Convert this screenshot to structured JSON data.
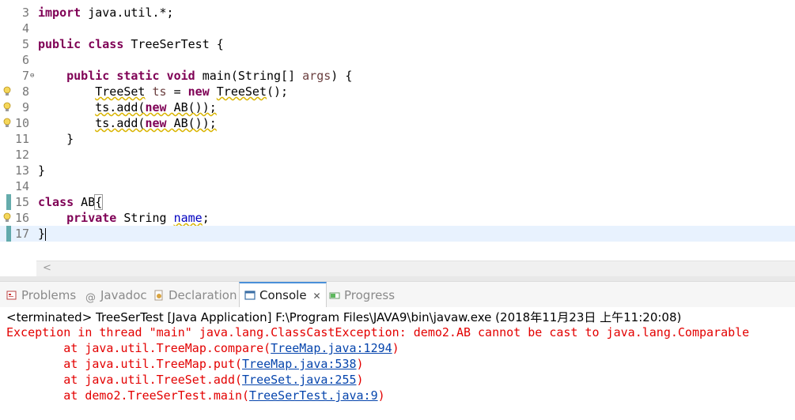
{
  "editor": {
    "lines": [
      {
        "n": "3",
        "tokens": [
          {
            "t": "import",
            "c": "kw"
          },
          {
            "t": " java.util.*;"
          }
        ]
      },
      {
        "n": "4",
        "tokens": []
      },
      {
        "n": "5",
        "tokens": [
          {
            "t": "public",
            "c": "kw"
          },
          {
            "t": " "
          },
          {
            "t": "class",
            "c": "kw"
          },
          {
            "t": " TreeSerTest {"
          }
        ]
      },
      {
        "n": "6",
        "tokens": []
      },
      {
        "n": "7",
        "fold": "⊖",
        "tokens": [
          {
            "t": "    "
          },
          {
            "t": "public",
            "c": "kw"
          },
          {
            "t": " "
          },
          {
            "t": "static",
            "c": "kw"
          },
          {
            "t": " "
          },
          {
            "t": "void",
            "c": "kw"
          },
          {
            "t": " main(String[] "
          },
          {
            "t": "args",
            "c": "param"
          },
          {
            "t": ") {"
          }
        ]
      },
      {
        "n": "8",
        "marker": "warning-lightbulb",
        "tokens": [
          {
            "t": "        "
          },
          {
            "t": "TreeSet",
            "c": "warn"
          },
          {
            "t": " "
          },
          {
            "t": "ts",
            "c": "param"
          },
          {
            "t": " = "
          },
          {
            "t": "new",
            "c": "kw"
          },
          {
            "t": " "
          },
          {
            "t": "TreeSet",
            "c": "warn"
          },
          {
            "t": "();"
          }
        ]
      },
      {
        "n": "9",
        "marker": "warning-lightbulb",
        "tokens": [
          {
            "t": "        "
          },
          {
            "t": "ts.add(",
            "c": "warn"
          },
          {
            "t": "new",
            "c": "kw warn"
          },
          {
            "t": " AB());",
            "c": "warn"
          }
        ]
      },
      {
        "n": "10",
        "marker": "warning-lightbulb",
        "tokens": [
          {
            "t": "        "
          },
          {
            "t": "ts.add(",
            "c": "warn"
          },
          {
            "t": "new",
            "c": "kw warn"
          },
          {
            "t": " AB());",
            "c": "warn"
          }
        ]
      },
      {
        "n": "11",
        "tokens": [
          {
            "t": "    }"
          }
        ]
      },
      {
        "n": "12",
        "tokens": []
      },
      {
        "n": "13",
        "tokens": [
          {
            "t": "}"
          }
        ]
      },
      {
        "n": "14",
        "tokens": []
      },
      {
        "n": "15",
        "ov": true,
        "tokens": [
          {
            "t": "class",
            "c": "kw"
          },
          {
            "t": " AB"
          },
          {
            "t": "{",
            "c": "boxed"
          }
        ]
      },
      {
        "n": "16",
        "marker": "warning-lightbulb",
        "tokens": [
          {
            "t": "    "
          },
          {
            "t": "private",
            "c": "kw"
          },
          {
            "t": " String "
          },
          {
            "t": "name",
            "c": "fld warn"
          },
          {
            "t": ";"
          }
        ]
      },
      {
        "n": "17",
        "ov": true,
        "current": true,
        "caret": true,
        "tokens": [
          {
            "t": "}"
          }
        ]
      }
    ],
    "hscroll_arrow": "<"
  },
  "tabs": [
    {
      "label": "Problems",
      "icon": "problems-icon",
      "active": false
    },
    {
      "label": "Javadoc",
      "icon": "javadoc-icon",
      "active": false
    },
    {
      "label": "Declaration",
      "icon": "declaration-icon",
      "active": false
    },
    {
      "label": "Console",
      "icon": "console-icon",
      "active": true
    },
    {
      "label": "Progress",
      "icon": "progress-icon",
      "active": false
    }
  ],
  "console": {
    "status": "<terminated> TreeSerTest [Java Application] F:\\Program Files\\JAVA9\\bin\\javaw.exe (2018年11月23日 上午11:20:08)",
    "exception": "Exception in thread \"main\" java.lang.ClassCastException: demo2.AB cannot be cast to java.lang.Comparable",
    "stack": [
      {
        "pre": "        at java.util.TreeMap.compare(",
        "link": "TreeMap.java:1294",
        "post": ")"
      },
      {
        "pre": "        at java.util.TreeMap.put(",
        "link": "TreeMap.java:538",
        "post": ")"
      },
      {
        "pre": "        at java.util.TreeSet.add(",
        "link": "TreeSet.java:255",
        "post": ")"
      },
      {
        "pre": "        at demo2.TreeSerTest.main(",
        "link": "TreeSerTest.java:9",
        "post": ")"
      }
    ]
  },
  "colors": {
    "keyword": "#7f0055",
    "error": "#e30000",
    "link": "#0645ad",
    "current_line": "#e8f2fe",
    "active_tab_accent": "#4a90d9"
  }
}
